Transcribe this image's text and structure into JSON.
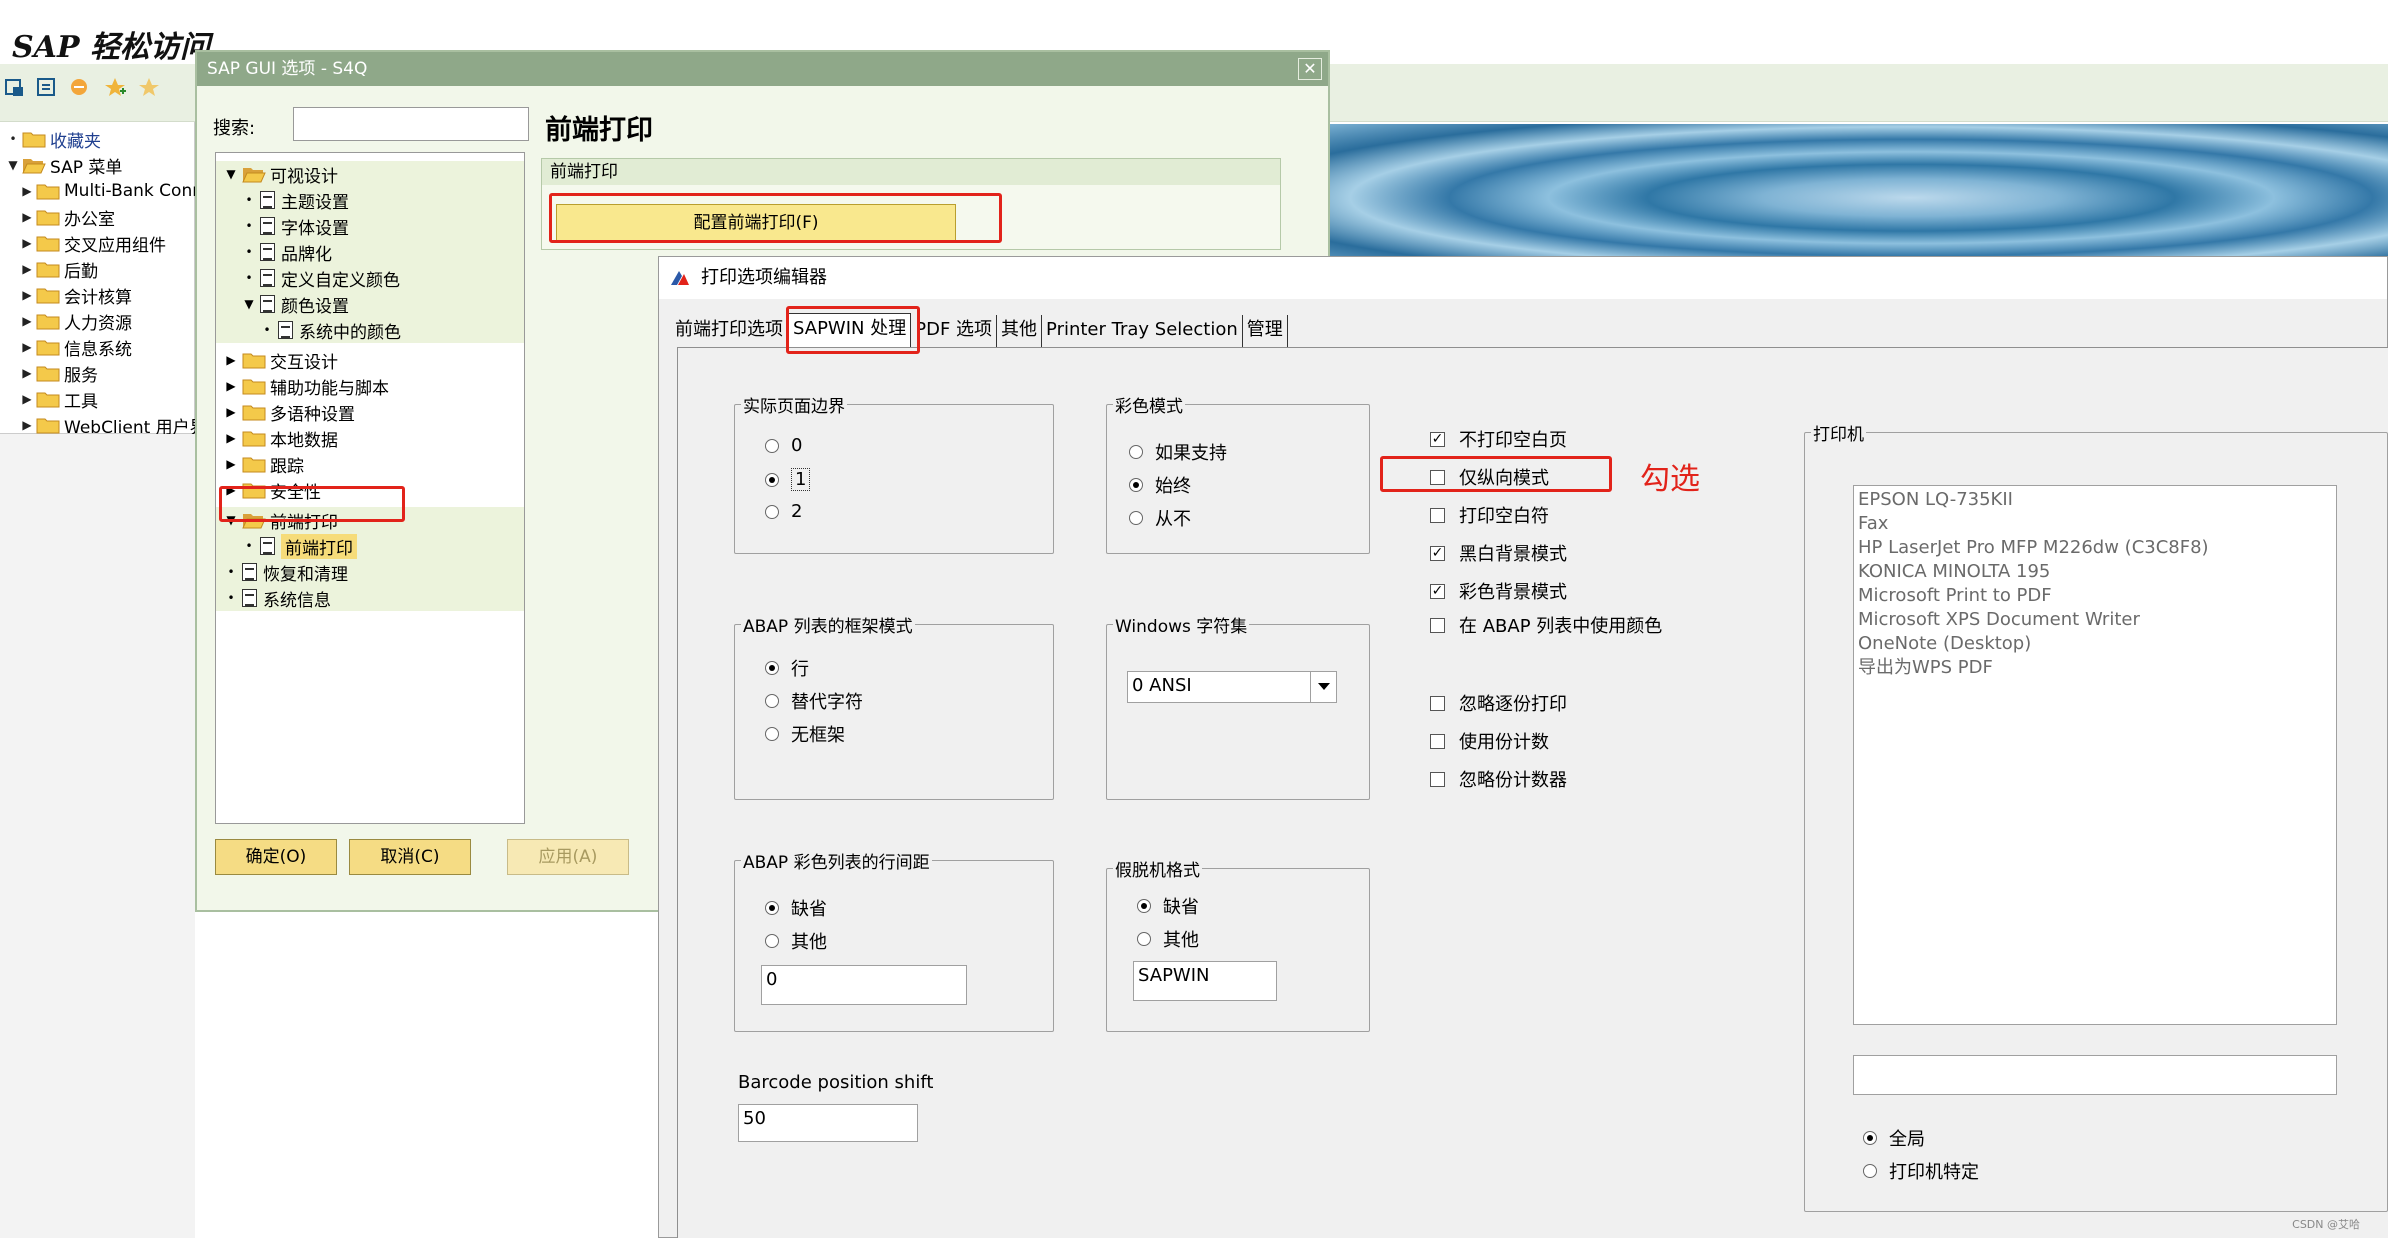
{
  "app": {
    "title": "SAP 轻松访问"
  },
  "easy_access": {
    "items": [
      {
        "label": "收藏夹",
        "kind": "root"
      },
      {
        "label": "SAP 菜单",
        "kind": "root"
      },
      {
        "label": "Multi-Bank Conn",
        "kind": "child"
      },
      {
        "label": "办公室",
        "kind": "child"
      },
      {
        "label": "交叉应用组件",
        "kind": "child"
      },
      {
        "label": "后勤",
        "kind": "child"
      },
      {
        "label": "会计核算",
        "kind": "child"
      },
      {
        "label": "人力资源",
        "kind": "child"
      },
      {
        "label": "信息系统",
        "kind": "child"
      },
      {
        "label": "服务",
        "kind": "child"
      },
      {
        "label": "工具",
        "kind": "child"
      },
      {
        "label": "WebClient 用户界",
        "kind": "child"
      }
    ]
  },
  "options_dialog": {
    "title": "SAP GUI 选项 - S4Q",
    "close_label": "✕",
    "search_label": "搜索:",
    "search_value": "",
    "heading": "前端打印",
    "group_title": "前端打印",
    "config_button": "配置前端打印(F)",
    "tree": [
      {
        "label": "可视设计",
        "type": "folder-open"
      },
      {
        "label": "主题设置",
        "type": "doc"
      },
      {
        "label": "字体设置",
        "type": "doc"
      },
      {
        "label": "品牌化",
        "type": "doc"
      },
      {
        "label": "定义自定义颜色",
        "type": "doc"
      },
      {
        "label": "颜色设置",
        "type": "doc-open"
      },
      {
        "label": "系统中的颜色",
        "type": "doc-sub"
      },
      {
        "label": "交互设计",
        "type": "folder"
      },
      {
        "label": "辅助功能与脚本",
        "type": "folder"
      },
      {
        "label": "多语种设置",
        "type": "folder"
      },
      {
        "label": "本地数据",
        "type": "folder"
      },
      {
        "label": "跟踪",
        "type": "folder"
      },
      {
        "label": "安全性",
        "type": "folder"
      },
      {
        "label": "前端打印",
        "type": "folder-open"
      },
      {
        "label": "前端打印",
        "type": "doc-selected"
      },
      {
        "label": "恢复和清理",
        "type": "doc-root"
      },
      {
        "label": "系统信息",
        "type": "doc-root"
      }
    ],
    "buttons": {
      "ok": "确定(O)",
      "cancel": "取消(C)",
      "apply": "应用(A)"
    }
  },
  "print_editor": {
    "title": "打印选项编辑器",
    "tabs": [
      "前端打印选项",
      "SAPWIN 处理",
      "PDF 选项",
      "其他",
      "Printer Tray Selection",
      "管理"
    ],
    "active_tab": "SAPWIN 处理",
    "page_margin": {
      "title": "实际页面边界",
      "options": [
        "0",
        "1",
        "2"
      ],
      "selected": "1"
    },
    "color_mode": {
      "title": "彩色模式",
      "options": [
        "如果支持",
        "始终",
        "从不"
      ],
      "selected": "始终"
    },
    "frame_mode": {
      "title": "ABAP 列表的框架模式",
      "options": [
        "行",
        "替代字符",
        "无框架"
      ],
      "selected": "行"
    },
    "charset": {
      "title": "Windows 字符集",
      "value": "0 ANSI"
    },
    "line_spacing": {
      "title": "ABAP 彩色列表的行间距",
      "options": [
        "缺省",
        "其他"
      ],
      "selected": "缺省",
      "value": "0"
    },
    "spool_format": {
      "title": "假脱机格式",
      "options": [
        "缺省",
        "其他"
      ],
      "selected": "缺省",
      "value": "SAPWIN"
    },
    "barcode": {
      "label": "Barcode position shift",
      "value": "50"
    },
    "checkboxes": [
      {
        "label": "不打印空白页",
        "checked": true
      },
      {
        "label": "仅纵向模式",
        "checked": false
      },
      {
        "label": "打印空白符",
        "checked": false
      },
      {
        "label": "黑白背景模式",
        "checked": true
      },
      {
        "label": "彩色背景模式",
        "checked": true
      },
      {
        "label": "在 ABAP 列表中使用颜色",
        "checked": false
      },
      {
        "label": "忽略逐份打印",
        "checked": false
      },
      {
        "label": "使用份计数",
        "checked": false
      },
      {
        "label": "忽略份计数器",
        "checked": false
      }
    ],
    "printers": {
      "title": "打印机",
      "items": [
        "EPSON LQ-735KII",
        "Fax",
        "HP LaserJet Pro MFP M226dw (C3C8F8)",
        "KONICA MINOLTA 195",
        "Microsoft Print to PDF",
        "Microsoft XPS Document Writer",
        "OneNote (Desktop)",
        "导出为WPS PDF"
      ],
      "scope_options": [
        "全局",
        "打印机特定"
      ],
      "selected_scope": "全局"
    }
  },
  "annotation": "勾选",
  "watermark": "CSDN @艾哈",
  "colors": {
    "highlight_red": "#e2231a",
    "button_yellow": "#f5dc84",
    "tree_highlight": "#ecf3dc"
  }
}
